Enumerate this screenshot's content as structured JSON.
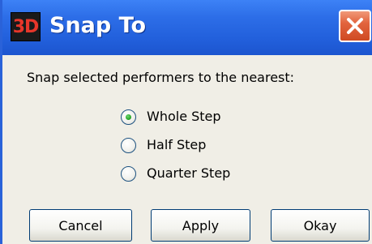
{
  "window": {
    "title": "Snap To",
    "icon_text": "3D",
    "icon_name": "app-3d-icon",
    "close_icon": "close-icon",
    "accent_color": "#2260dc",
    "close_color": "#e2643e"
  },
  "dialog": {
    "prompt": "Snap selected performers to the nearest:",
    "options": [
      {
        "label": "Whole Step",
        "selected": true
      },
      {
        "label": "Half Step",
        "selected": false
      },
      {
        "label": "Quarter Step",
        "selected": false
      }
    ]
  },
  "buttons": {
    "cancel": "Cancel",
    "apply": "Apply",
    "okay": "Okay"
  }
}
